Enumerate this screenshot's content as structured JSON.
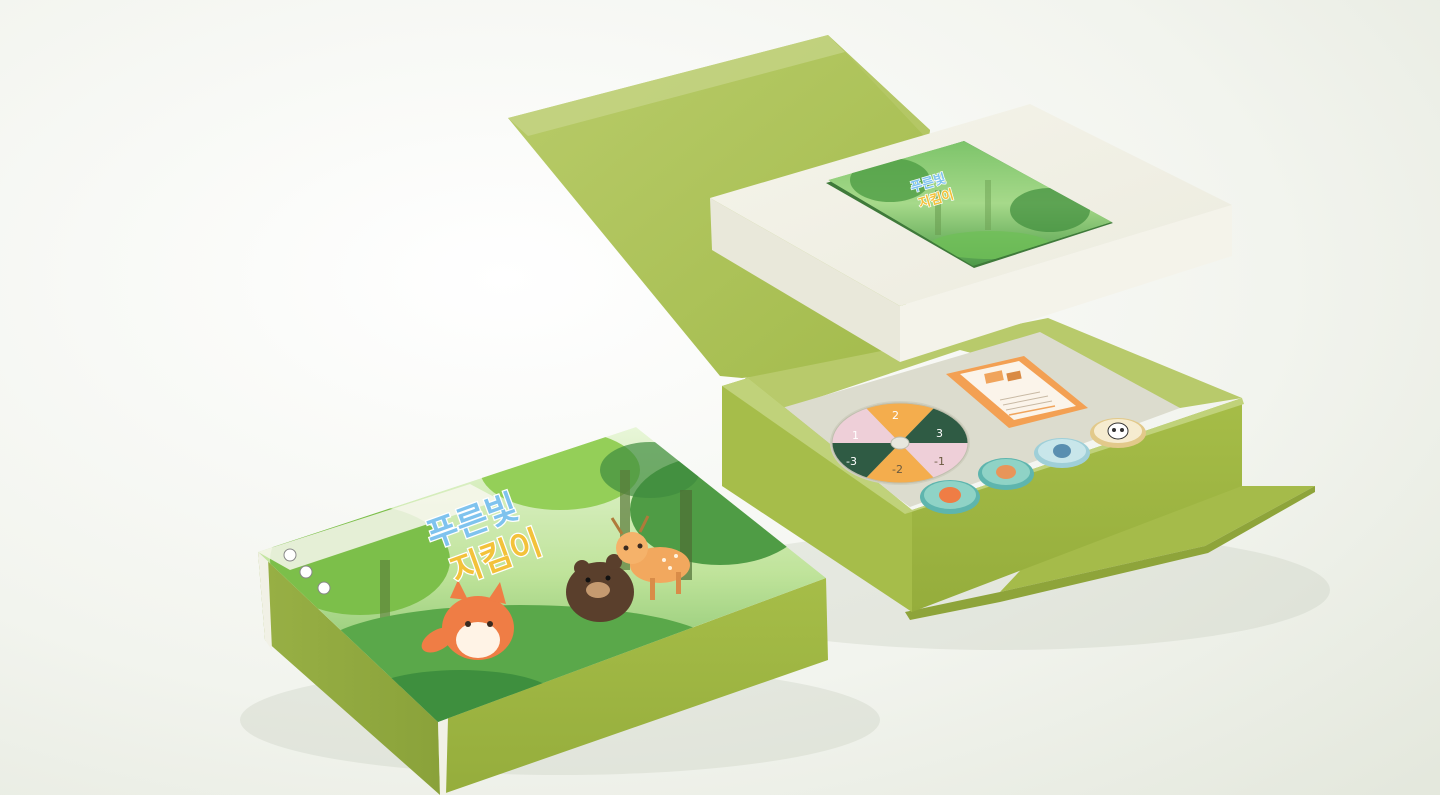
{
  "product": {
    "cover_title_line1": "푸른빛",
    "cover_title_line2": "지킴이",
    "booklet_title_line1": "푸른빛",
    "booklet_title_line2": "지킴이"
  },
  "spinner": {
    "segments": [
      "1",
      "2",
      "3",
      "-1",
      "-2",
      "-3"
    ]
  },
  "tokens": [
    {
      "animal": "fox-icon"
    },
    {
      "animal": "deer-icon"
    },
    {
      "animal": "owl-icon"
    },
    {
      "animal": "panda-icon"
    }
  ],
  "colors": {
    "background": "#eef1e9",
    "box_green": "#a9bf4f",
    "box_green_dark": "#8fa63a",
    "lid_white": "#f2f1e6",
    "tray": "#ddddd0",
    "card_orange": "#f5a25a",
    "forest_green": "#5faa4a"
  }
}
